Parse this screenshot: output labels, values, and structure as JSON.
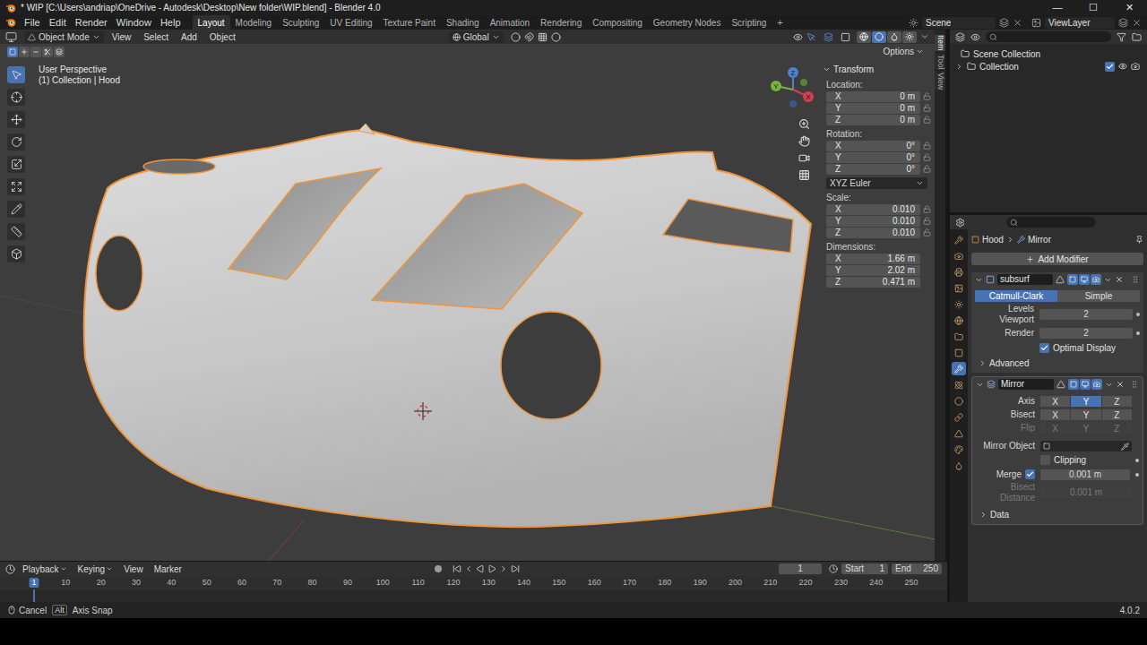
{
  "window": {
    "title": "* WIP [C:\\Users\\andriap\\OneDrive - Autodesk\\Desktop\\New folder\\WIP.blend] - Blender 4.0",
    "controls": [
      "—",
      "☐",
      "✕"
    ]
  },
  "menu": [
    "File",
    "Edit",
    "Render",
    "Window",
    "Help"
  ],
  "workspaces": [
    {
      "label": "Layout",
      "selected": true
    },
    {
      "label": "Modeling",
      "selected": false
    },
    {
      "label": "Sculpting",
      "selected": false
    },
    {
      "label": "UV Editing",
      "selected": false
    },
    {
      "label": "Texture Paint",
      "selected": false
    },
    {
      "label": "Shading",
      "selected": false
    },
    {
      "label": "Animation",
      "selected": false
    },
    {
      "label": "Rendering",
      "selected": false
    },
    {
      "label": "Compositing",
      "selected": false
    },
    {
      "label": "Geometry Nodes",
      "selected": false
    },
    {
      "label": "Scripting",
      "selected": false
    }
  ],
  "add_workspace": "+",
  "scene": "Scene",
  "view_layer": "ViewLayer",
  "viewport": {
    "mode": "Object Mode",
    "menus": [
      "View",
      "Select",
      "Add",
      "Object"
    ],
    "orientation": "Global",
    "options": "Options",
    "view_name": "User Perspective",
    "context": "(1) Collection | Hood",
    "gizmo": [
      "X",
      "Y",
      "Z"
    ],
    "select_modes": [
      {
        "kind": "new",
        "selected": true
      },
      {
        "kind": "extend",
        "selected": false
      },
      {
        "kind": "subtract",
        "selected": false
      },
      {
        "kind": "invert",
        "selected": false
      },
      {
        "kind": "intersect",
        "selected": false
      }
    ],
    "shading": [
      {
        "kind": "wireframe",
        "selected": false
      },
      {
        "kind": "solid",
        "selected": true
      },
      {
        "kind": "material",
        "selected": false
      },
      {
        "kind": "rendered",
        "selected": false
      }
    ],
    "tools": [
      {
        "kind": "select",
        "selected": true
      },
      {
        "kind": "cursor",
        "selected": false
      },
      {
        "kind": "move",
        "selected": false
      },
      {
        "kind": "rotate",
        "selected": false
      },
      {
        "kind": "scale",
        "selected": false
      },
      {
        "kind": "transform",
        "selected": false
      },
      {
        "kind": "annotate",
        "selected": false
      },
      {
        "kind": "measure",
        "selected": false
      },
      {
        "kind": "add_cube",
        "selected": false
      }
    ]
  },
  "sidebar": {
    "title": "Transform",
    "tabs": [
      {
        "label": "Item",
        "selected": true
      },
      {
        "label": "Tool",
        "selected": false
      },
      {
        "label": "View",
        "selected": false
      }
    ],
    "groups": [
      {
        "label": "Location:",
        "lockable": true,
        "fields": [
          {
            "axis": "X",
            "value": "0 m",
            "locked": false
          },
          {
            "axis": "Y",
            "value": "0 m",
            "locked": false
          },
          {
            "axis": "Z",
            "value": "0 m",
            "locked": false
          }
        ]
      },
      {
        "label": "Rotation:",
        "lockable": true,
        "mode": "XYZ Euler",
        "fields": [
          {
            "axis": "X",
            "value": "0°",
            "locked": false
          },
          {
            "axis": "Y",
            "value": "0°",
            "locked": false
          },
          {
            "axis": "Z",
            "value": "0°",
            "locked": false
          }
        ]
      },
      {
        "label": "Scale:",
        "lockable": true,
        "fields": [
          {
            "axis": "X",
            "value": "0.010",
            "locked": false
          },
          {
            "axis": "Y",
            "value": "0.010",
            "locked": false
          },
          {
            "axis": "Z",
            "value": "0.010",
            "locked": false
          }
        ]
      },
      {
        "label": "Dimensions:",
        "lockable": false,
        "fields": [
          {
            "axis": "X",
            "value": "1.66 m",
            "locked": false
          },
          {
            "axis": "Y",
            "value": "2.02 m",
            "locked": false
          },
          {
            "axis": "Z",
            "value": "0.471 m",
            "locked": false
          }
        ]
      }
    ]
  },
  "outliner": {
    "items": [
      {
        "label": "Scene Collection",
        "kind": "root",
        "expanded": true,
        "checked": true,
        "visible": true
      },
      {
        "label": "Collection",
        "kind": "collection",
        "expanded": false,
        "checked": true,
        "visible": true
      }
    ]
  },
  "properties": {
    "breadcrumb": [
      "Hood",
      "Mirror"
    ],
    "add_modifier": "Add Modifier",
    "tabs": [
      {
        "kind": "tool",
        "selected": false
      },
      {
        "kind": "render",
        "selected": false
      },
      {
        "kind": "output",
        "selected": false
      },
      {
        "kind": "view_layer",
        "selected": false
      },
      {
        "kind": "scene",
        "selected": false
      },
      {
        "kind": "world",
        "selected": false
      },
      {
        "kind": "collection",
        "selected": false
      },
      {
        "kind": "object",
        "selected": false
      },
      {
        "kind": "modifiers",
        "selected": true
      },
      {
        "kind": "particles",
        "selected": false
      },
      {
        "kind": "physics",
        "selected": false
      },
      {
        "kind": "constraints",
        "selected": false
      },
      {
        "kind": "data",
        "selected": false
      },
      {
        "kind": "material",
        "selected": false
      },
      {
        "kind": "texture",
        "selected": false
      }
    ],
    "subsurf": {
      "name": "subsurf",
      "expanded": true,
      "modes": [
        {
          "label": "Catmull-Clark",
          "selected": true
        },
        {
          "label": "Simple",
          "selected": false
        }
      ],
      "fields": [
        {
          "label": "Levels Viewport",
          "value": "2"
        },
        {
          "label": "Render",
          "value": "2"
        }
      ],
      "optimal_display": {
        "label": "Optimal Display",
        "checked": true
      },
      "advanced": {
        "label": "Advanced",
        "expanded": false
      }
    },
    "mirror": {
      "name": "Mirror",
      "expanded": true,
      "axis_rows": [
        {
          "label": "Axis",
          "disabled": false,
          "buttons": [
            {
              "label": "X",
              "selected": false
            },
            {
              "label": "Y",
              "selected": true
            },
            {
              "label": "Z",
              "selected": false
            }
          ]
        },
        {
          "label": "Bisect",
          "disabled": false,
          "buttons": [
            {
              "label": "X",
              "selected": false
            },
            {
              "label": "Y",
              "selected": false
            },
            {
              "label": "Z",
              "selected": false
            }
          ]
        },
        {
          "label": "Flip",
          "disabled": true,
          "buttons": [
            {
              "label": "X",
              "selected": false
            },
            {
              "label": "Y",
              "selected": false
            },
            {
              "label": "Z",
              "selected": false
            }
          ]
        }
      ],
      "mirror_object": {
        "label": "Mirror Object",
        "value": ""
      },
      "clipping": {
        "label": "Clipping",
        "checked": false
      },
      "merge": {
        "label": "Merge",
        "checked": true,
        "value": "0.001 m"
      },
      "bisect_distance": {
        "label": "Bisect Distance",
        "value": "0.001 m",
        "disabled": true
      },
      "data": {
        "label": "Data",
        "expanded": false
      }
    }
  },
  "timeline": {
    "menus": [
      {
        "label": "Playback",
        "dropdown": true
      },
      {
        "label": "Keying",
        "dropdown": true
      },
      {
        "label": "View",
        "dropdown": false
      },
      {
        "label": "Marker",
        "dropdown": false
      }
    ],
    "current_frame": "1",
    "start_label": "Start",
    "start": "1",
    "end_label": "End",
    "end": "250",
    "ruler": [
      "1",
      "10",
      "20",
      "30",
      "40",
      "50",
      "60",
      "70",
      "80",
      "90",
      "100",
      "110",
      "120",
      "130",
      "140",
      "150",
      "160",
      "170",
      "180",
      "190",
      "200",
      "210",
      "220",
      "230",
      "240",
      "250"
    ]
  },
  "status": {
    "hints": [
      {
        "kind": "mouse",
        "label": "Cancel"
      },
      {
        "kind": "key",
        "label": "Alt"
      },
      {
        "kind": "text",
        "label": "Axis Snap"
      }
    ],
    "version": "4.0.2"
  }
}
